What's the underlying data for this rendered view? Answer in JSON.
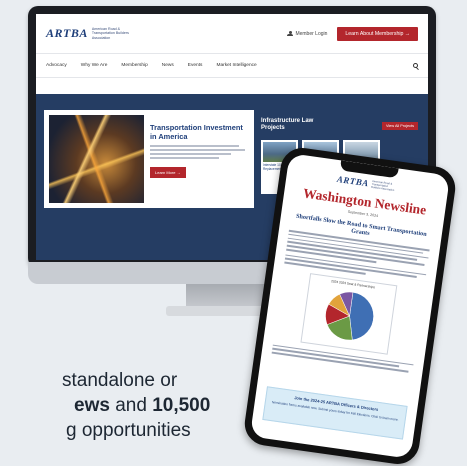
{
  "site": {
    "logo": "ARTBA",
    "logo_subtitle": "American Road & Transportation Builders Association",
    "member_login": "Member Login",
    "cta_button": "Learn About Membership →",
    "nav": [
      "Advocacy",
      "Why We Are",
      "Membership",
      "News",
      "Events",
      "Market Intelligence"
    ],
    "feature": {
      "title": "Transportation Investment in America",
      "button": "Learn More →"
    },
    "iija": {
      "title": "Infrastructure Law Projects",
      "view_all": "View All Projects",
      "projects": [
        "Interstate 10 Bridge Replacement",
        "",
        ""
      ]
    }
  },
  "newsletter": {
    "logo": "ARTBA",
    "logo_subtitle": "American Road & Transportation Builders Association",
    "title": "Washington Newsline",
    "date": "September 3, 2024",
    "heading": "Shortfalls Slow the Road to Smart Transportation Grants",
    "chart_title": "2024 2023 Seat & Partnerships",
    "chart_slices": [
      {
        "value": 0.46,
        "color": "#3f6fb4"
      },
      {
        "value": 0.21,
        "color": "#6b9a45"
      },
      {
        "value": 0.14,
        "color": "#b3262c"
      },
      {
        "value": 0.1,
        "color": "#e2a33b"
      },
      {
        "value": 0.09,
        "color": "#7b57a3"
      }
    ],
    "callout_title": "Join the 2024-25 ARTBA Officers & Directors",
    "callout_text": "Nomination forms available now. Submit yours today for Fall Elections. Click to learn more."
  },
  "promo": {
    "line1": "standalone or",
    "views": "ews",
    "and": " and ",
    "count": "10,500",
    "line3": "g opportunities"
  }
}
